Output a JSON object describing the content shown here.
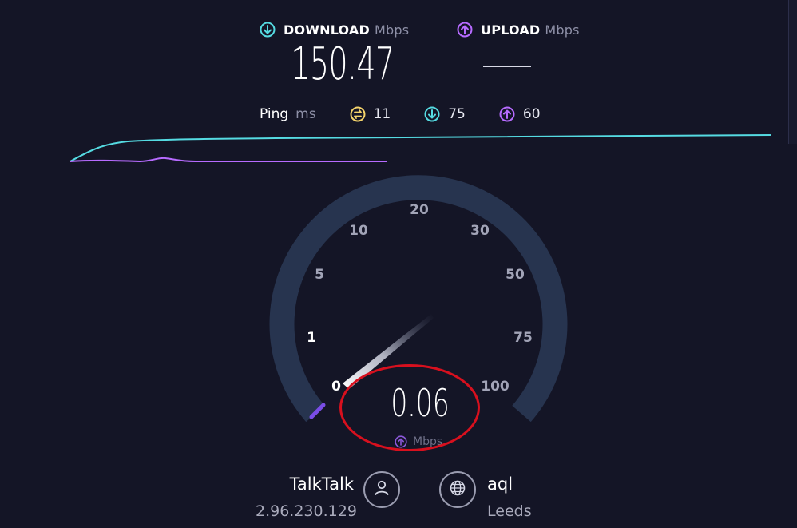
{
  "header": {
    "download": {
      "title": "DOWNLOAD",
      "unit": "Mbps",
      "value": "150.47",
      "icon": "download-icon",
      "color": "#55dbe2"
    },
    "upload": {
      "title": "UPLOAD",
      "unit": "Mbps",
      "value": "—",
      "icon": "upload-icon",
      "color": "#b76bff"
    }
  },
  "ping": {
    "label": "Ping",
    "unit": "ms",
    "idle": {
      "value": "11",
      "icon": "idle-ping-icon",
      "color": "#f4d36b"
    },
    "download": {
      "value": "75",
      "icon": "download-ping-icon",
      "color": "#55dbe2"
    },
    "upload": {
      "value": "60",
      "icon": "upload-ping-icon",
      "color": "#b76bff"
    }
  },
  "gauge": {
    "labels": [
      "0",
      "1",
      "5",
      "10",
      "20",
      "30",
      "50",
      "75",
      "100"
    ],
    "current_value": "0.06",
    "current_unit": "Mbps",
    "current_icon": "upload-icon",
    "needle_value": 0.06
  },
  "provider": {
    "isp": {
      "name": "TalkTalk",
      "ip": "2.96.230.129",
      "icon": "user-icon"
    },
    "server": {
      "name": "aql",
      "location": "Leeds",
      "icon": "globe-icon"
    }
  },
  "colors": {
    "background": "#141526",
    "gauge_track": "#27344f",
    "download": "#55dbe2",
    "upload": "#b76bff",
    "highlight": "#d8101e"
  }
}
